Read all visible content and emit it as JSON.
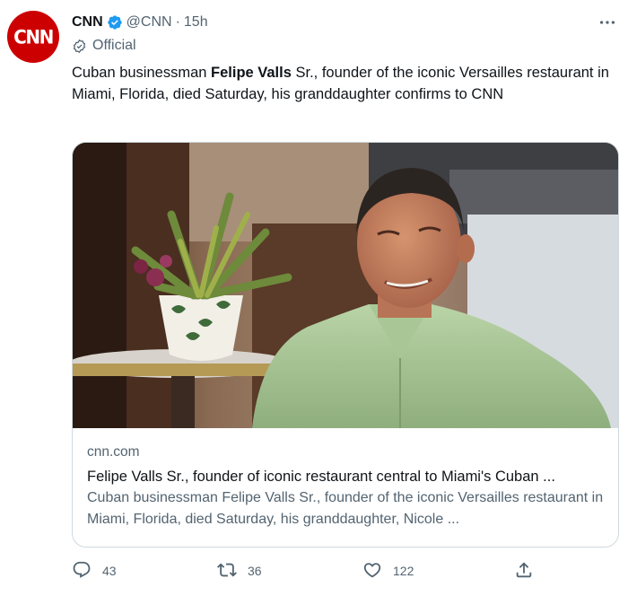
{
  "author": {
    "avatar_text": "CNN",
    "name": "CNN",
    "handle": "@CNN",
    "separator": "·",
    "time": "15h",
    "label": "Official"
  },
  "tweet": {
    "text_before": "Cuban businessman ",
    "text_bold": "Felipe Valls",
    "text_after": " Sr., founder of the iconic Versailles restaurant in Miami, Florida, died Saturday, his granddaughter confirms to CNN"
  },
  "card": {
    "domain": "cnn.com",
    "title": "Felipe Valls Sr., founder of iconic restaurant central to Miami's Cuban ...",
    "description": "Cuban businessman Felipe Valls Sr., founder of the iconic Versailles restaurant in Miami, Florida, died Saturday, his granddaughter, Nicole ..."
  },
  "actions": {
    "replies": "43",
    "retweets": "36",
    "likes": "122"
  },
  "icons": {
    "more": "more-horizontal-icon",
    "verified": "verified-badge-icon",
    "official": "official-check-icon",
    "reply": "reply-icon",
    "retweet": "retweet-icon",
    "like": "heart-icon",
    "share": "share-icon"
  },
  "colors": {
    "brand": "#cc0000",
    "verified": "#1d9bf0",
    "text": "#0f1419",
    "muted": "#536471",
    "border": "#cfd9de"
  }
}
